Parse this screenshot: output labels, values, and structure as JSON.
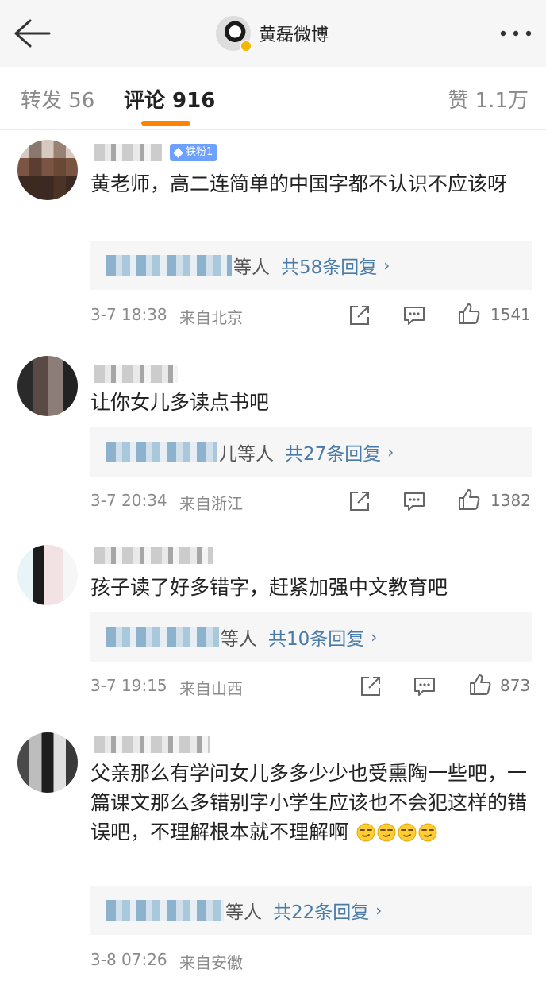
{
  "header": {
    "title": "黄磊微博"
  },
  "tabs": {
    "repost": "转发 56",
    "comments": "评论 916",
    "likes": "赞 1.1万"
  },
  "comments": [
    {
      "badge": "铁粉1",
      "text": "黄老师，高二连简单的中国字都不认识不应该呀",
      "reply_tail": "等人",
      "reply_count": "共58条回复",
      "time": "3-7 18:38",
      "location": "来自北京",
      "likes": "1541"
    },
    {
      "text": "让你女儿多读点书吧",
      "reply_tail": "儿等人",
      "reply_count": "共27条回复",
      "time": "3-7 20:34",
      "location": "来自浙江",
      "likes": "1382"
    },
    {
      "text": "孩子读了好多错字，赶紧加强中文教育吧",
      "reply_tail": "等人",
      "reply_count": "共10条回复",
      "time": "3-7 19:15",
      "location": "来自山西",
      "likes": "873"
    },
    {
      "text": "父亲那么有学问女儿多多少少也受熏陶一些吧，一篇课文那么多错别字小学生应该也不会犯这样的错误吧，不理解根本就不理解啊",
      "reply_tail": "等人",
      "reply_count": "共22条回复",
      "time": "3-8 07:26",
      "location": "来自安徽"
    }
  ],
  "chevron": "›",
  "colors": {
    "accent": "#ff8200",
    "link": "#4a7aa8",
    "badge": "#6ea0ff"
  },
  "icons": [
    "back-arrow-icon",
    "more-icon",
    "share-icon",
    "comment-icon",
    "like-icon",
    "smirk-emoji-icon"
  ]
}
